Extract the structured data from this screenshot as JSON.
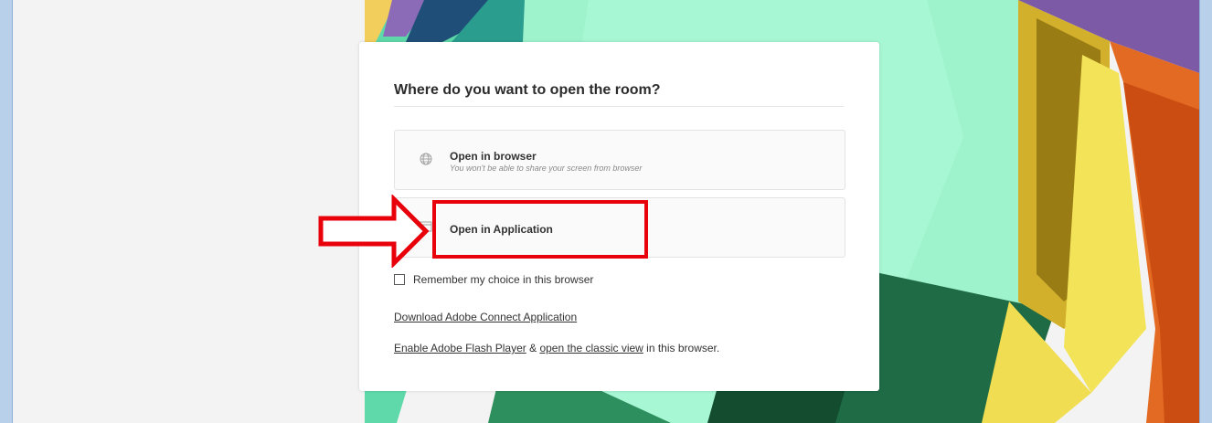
{
  "dialog": {
    "title": "Where do you want to open the room?",
    "options": [
      {
        "label": "Open in browser",
        "subtitle": "You won't be able to share your screen from browser",
        "icon": "globe-icon"
      },
      {
        "label": "Open in Application",
        "icon": "application-icon"
      }
    ],
    "remember_label": "Remember my choice in this browser",
    "remember_checked": false,
    "download_link": "Download Adobe Connect Application",
    "flash_link": "Enable Adobe Flash Player",
    "flash_joiner": " & ",
    "classic_link": "open the classic view",
    "flash_suffix": " in this browser."
  },
  "annotation": {
    "color": "#e8000b"
  }
}
